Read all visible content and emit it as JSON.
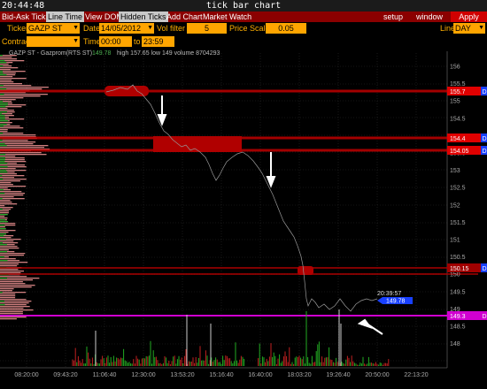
{
  "window": {
    "clock": "20:44:48",
    "title": "tick bar chart"
  },
  "menu": {
    "items": [
      "Bid-Ask Tick",
      "Line Time",
      "View DOM",
      "Hidden Ticks",
      "Add Chart",
      "Market Watch"
    ],
    "right": [
      "setup",
      "window",
      "Apply"
    ]
  },
  "toolbar": {
    "ticker_label": "Ticker",
    "ticker_value": "GAZP ST",
    "date_label": "Date",
    "date_value": "14/05/2012",
    "vol_filter_label": "Vol filter",
    "vol_filter_value": "5",
    "price_scale_label": "Price Scale",
    "price_scale_value": "0.05",
    "line_label": "Line",
    "line_value": "DAY",
    "contract_label": "Contract",
    "time_label": "Time",
    "time_from": "00:00",
    "to_label": "to",
    "time_to": "23:59"
  },
  "chart_info": {
    "symbol": "GAZP ST - Gazprom(RTS ST)",
    "last": "149.78",
    "stats": "high 157.65  low 149  volume 8704293"
  },
  "price_ticks": [
    "156",
    "155.5",
    "155",
    "154.5",
    "154",
    "153.5",
    "153",
    "152.5",
    "152",
    "151.5",
    "151",
    "150.5",
    "150",
    "149.5",
    "149",
    "148.5",
    "148"
  ],
  "time_ticks": [
    "08:20:00",
    "09:43:20",
    "11:06:40",
    "12:30:00",
    "13:53:20",
    "15:16:40",
    "16:40:00",
    "18:03:20",
    "19:26:40",
    "20:50:00",
    "22:13:20"
  ],
  "price_tags": [
    {
      "label": "155.7",
      "color": "#e00000"
    },
    {
      "label": "154.4",
      "color": "#e00000"
    },
    {
      "label": "154.05",
      "color": "#e00000"
    },
    {
      "label": "150.15",
      "color": "#a00000"
    },
    {
      "label": "149.3",
      "color": "#d000d0"
    }
  ],
  "last_tag": {
    "time": "20:39:57",
    "price": "149.78"
  },
  "colors": {
    "menu_bg": "#8b0000",
    "field_bg": "#ffa500",
    "label": "#ffb000",
    "magenta": "#d000d0",
    "red_zone": "#c00000",
    "last_price_bg": "#1840ff"
  },
  "icons": [
    "menu-dropdown-arrow-icon",
    "annotation-arrow-icon"
  ]
}
